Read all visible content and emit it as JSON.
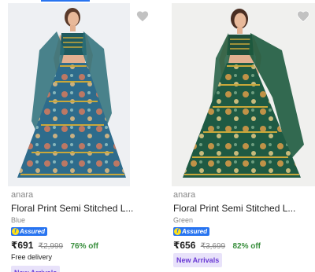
{
  "colors": {
    "accent": "#2874f0",
    "discount": "#388e3c",
    "badge_bg": "#e8e2fa",
    "badge_text": "#6a3ad4",
    "assured_bg": "#2874f0",
    "assured_mark": "#ffe11b"
  },
  "products": [
    {
      "image": "lehenga-teal-photo",
      "wishlist_icon": "heart-icon",
      "brand": "anara",
      "title": "Floral Print Semi Stitched L...",
      "variant": "Blue",
      "assured_label": "Assured",
      "price": "₹691",
      "mrp": "₹2,999",
      "discount": "76% off",
      "delivery": "Free delivery",
      "badge": "New Arrivals"
    },
    {
      "image": "lehenga-green-photo",
      "wishlist_icon": "heart-icon",
      "brand": "anara",
      "title": "Floral Print Semi Stitched L...",
      "variant": "Green",
      "assured_label": "Assured",
      "price": "₹656",
      "mrp": "₹3,699",
      "discount": "82% off",
      "badge": "New Arrivals"
    }
  ]
}
